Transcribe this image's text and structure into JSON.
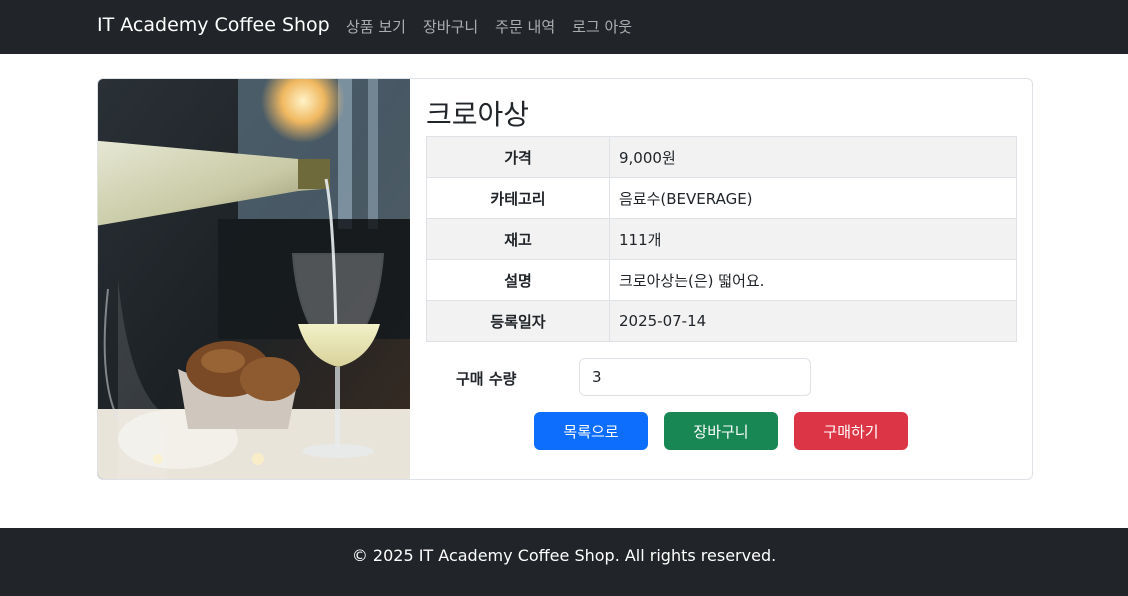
{
  "navbar": {
    "brand": "IT Academy Coffee Shop",
    "links": [
      "상품 보기",
      "장바구니",
      "주문 내역",
      "로그 아웃"
    ]
  },
  "product": {
    "image_icon": "wine-pouring-photo",
    "name": "크로아상",
    "rows": [
      {
        "label": "가격",
        "value": "9,000원"
      },
      {
        "label": "카테고리",
        "value": "음료수(BEVERAGE)"
      },
      {
        "label": "재고",
        "value": "111개"
      },
      {
        "label": "설명",
        "value": "크로아상는(은) 떫어요."
      },
      {
        "label": "등록일자",
        "value": "2025-07-14"
      }
    ],
    "quantity_label": "구매 수량",
    "quantity_value": "3"
  },
  "buttons": {
    "list": "목록으로",
    "cart": "장바구니",
    "buy": "구매하기"
  },
  "colors": {
    "navbar": "#212529",
    "primary": "#0d6efd",
    "success": "#198754",
    "danger": "#dc3545"
  },
  "footer": {
    "text": "© 2025 IT Academy Coffee Shop. All rights reserved."
  }
}
